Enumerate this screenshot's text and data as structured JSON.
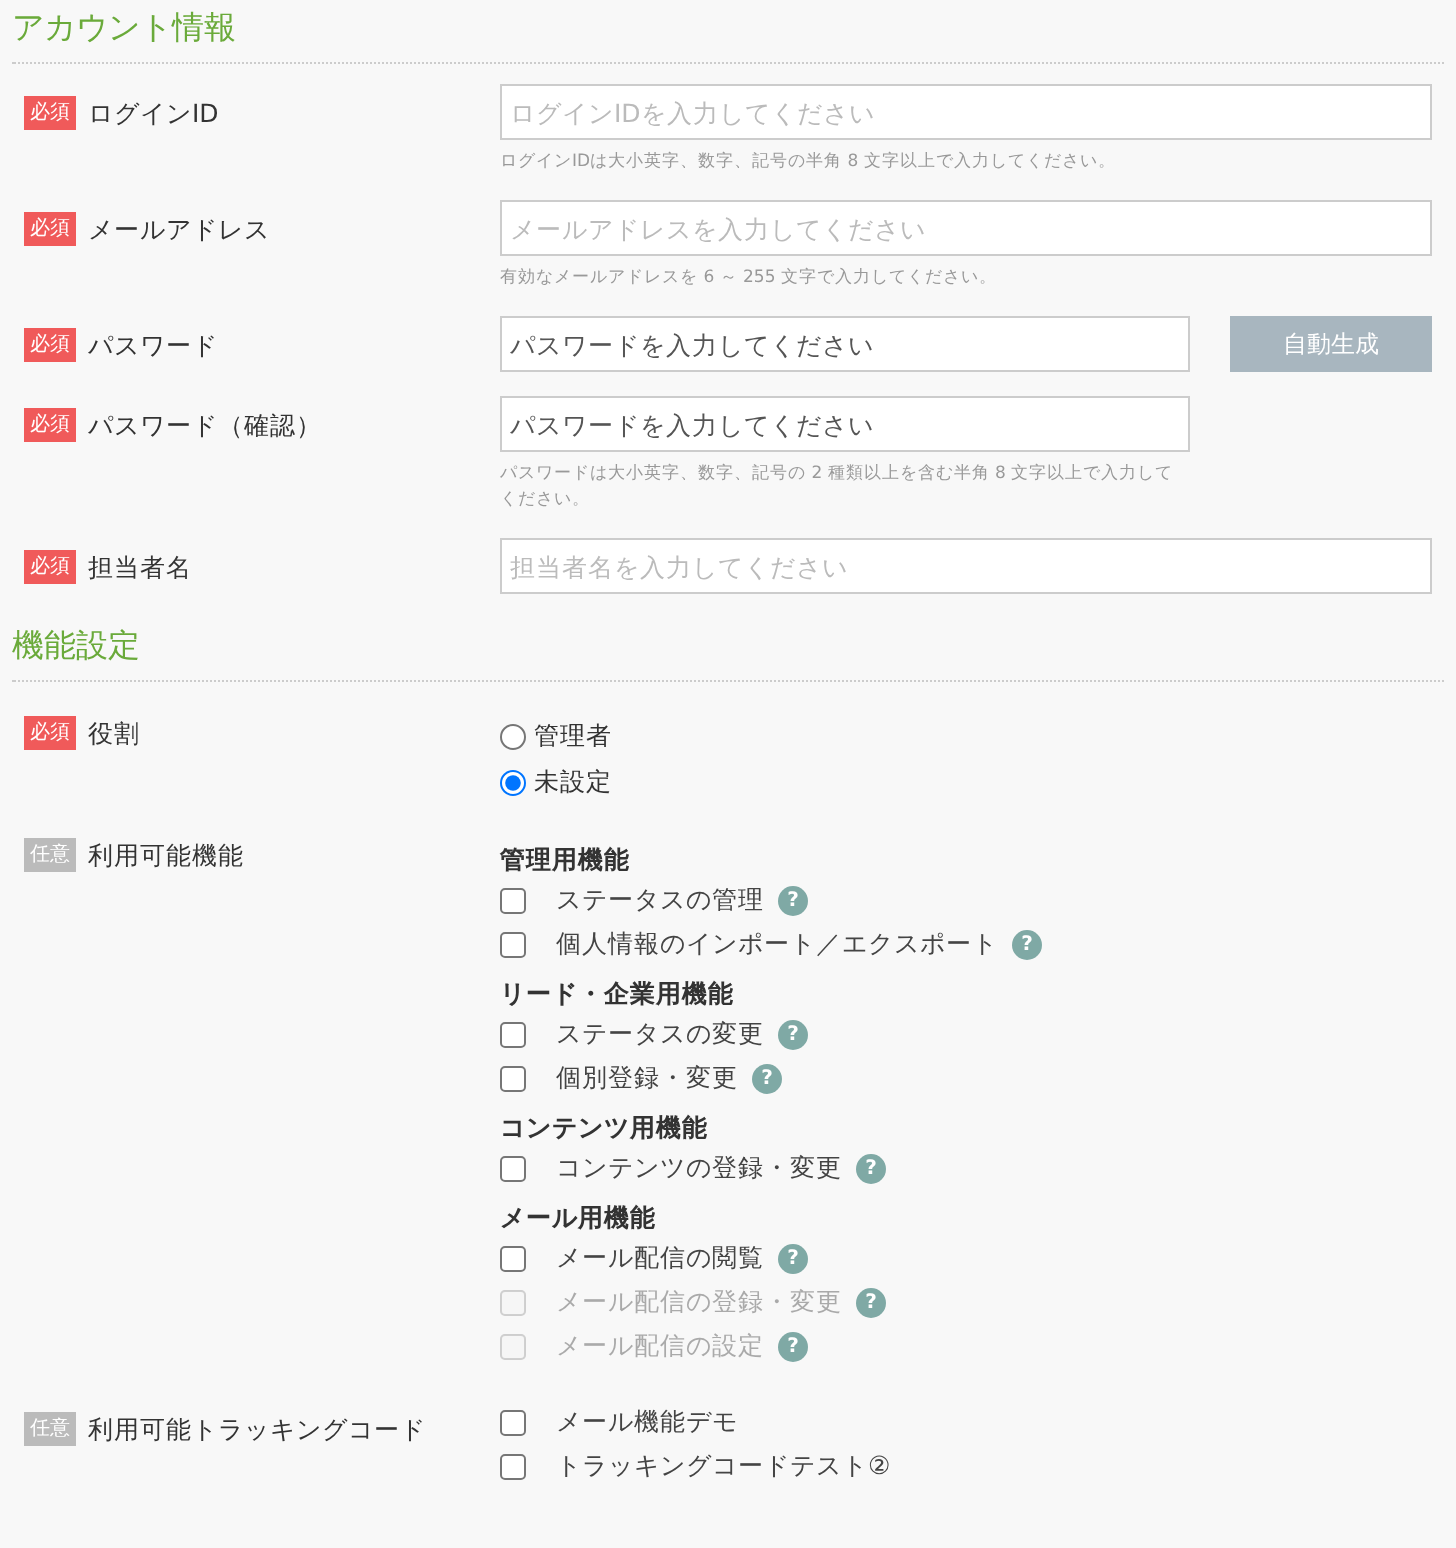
{
  "sections": [
    {
      "title": "アカウント情報",
      "fields": [
        {
          "kind": "text",
          "badge": {
            "text": "必須",
            "kind": "required"
          },
          "label": "ログインID",
          "placeholder": "ログインIDを入力してください",
          "help": "ログインIDは大小英字、数字、記号の半角 8 文字以上で入力してください。"
        },
        {
          "kind": "text",
          "badge": {
            "text": "必須",
            "kind": "required"
          },
          "label": "メールアドレス",
          "placeholder": "メールアドレスを入力してください",
          "help": "有効なメールアドレスを 6 ～ 255 文字で入力してください。"
        },
        {
          "kind": "password",
          "badge": {
            "text": "必須",
            "kind": "required"
          },
          "label": "パスワード",
          "placeholder": "パスワードを入力してください",
          "button": "自動生成"
        },
        {
          "kind": "password",
          "badge": {
            "text": "必須",
            "kind": "required"
          },
          "label": "パスワード（確認）",
          "placeholder": "パスワードを入力してください",
          "help": "パスワードは大小英字、数字、記号の 2 種類以上を含む半角 8 文字以上で入力してください。"
        },
        {
          "kind": "text",
          "badge": {
            "text": "必須",
            "kind": "required"
          },
          "label": "担当者名",
          "placeholder": "担当者名を入力してください"
        }
      ]
    },
    {
      "title": "機能設定",
      "fields": [
        {
          "kind": "radio",
          "badge": {
            "text": "必須",
            "kind": "required"
          },
          "label": "役割",
          "options": [
            {
              "label": "管理者",
              "selected": false
            },
            {
              "label": "未設定",
              "selected": true
            }
          ]
        },
        {
          "kind": "checks",
          "badge": {
            "text": "任意",
            "kind": "optional"
          },
          "label": "利用可能機能",
          "groups": [
            {
              "title": "管理用機能",
              "items": [
                {
                  "label": "ステータスの管理",
                  "checked": false,
                  "disabled": false,
                  "tip": "?"
                },
                {
                  "label": "個人情報のインポート／エクスポート",
                  "checked": false,
                  "disabled": false,
                  "tip": "?"
                }
              ]
            },
            {
              "title": "リード・企業用機能",
              "items": [
                {
                  "label": "ステータスの変更",
                  "checked": false,
                  "disabled": false,
                  "tip": "?"
                },
                {
                  "label": "個別登録・変更",
                  "checked": false,
                  "disabled": false,
                  "tip": "?"
                }
              ]
            },
            {
              "title": "コンテンツ用機能",
              "items": [
                {
                  "label": "コンテンツの登録・変更",
                  "checked": false,
                  "disabled": false,
                  "tip": "?"
                }
              ]
            },
            {
              "title": "メール用機能",
              "items": [
                {
                  "label": "メール配信の閲覧",
                  "checked": false,
                  "disabled": false,
                  "tip": "?"
                },
                {
                  "label": "メール配信の登録・変更",
                  "checked": false,
                  "disabled": true,
                  "tip": "?"
                },
                {
                  "label": "メール配信の設定",
                  "checked": false,
                  "disabled": true,
                  "tip": "?"
                }
              ]
            }
          ]
        },
        {
          "kind": "checks",
          "badge": {
            "text": "任意",
            "kind": "optional"
          },
          "label": "利用可能トラッキングコード",
          "groups": [
            {
              "items": [
                {
                  "label": "メール機能デモ",
                  "checked": false,
                  "disabled": false
                },
                {
                  "label": "トラッキングコードテスト②",
                  "checked": false,
                  "disabled": false
                }
              ]
            }
          ]
        }
      ]
    }
  ]
}
